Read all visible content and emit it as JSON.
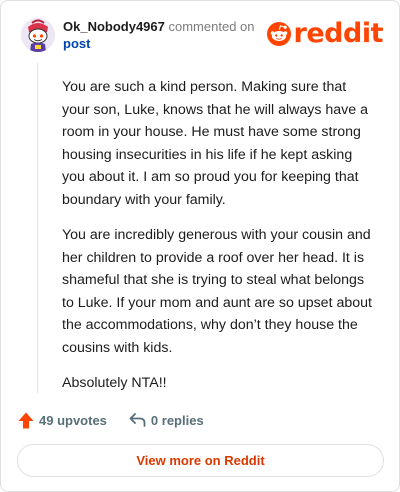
{
  "header": {
    "username": "Ok_Nobody4967",
    "commented_text": "commented on",
    "post_link": "post",
    "logo_text": "reddit"
  },
  "comment": {
    "paragraphs": [
      "You are such a kind person. Making sure that your son, Luke, knows that he will always have a room in your house. He must have some strong housing insecurities in his life if he kept asking you about it. I am so proud you for keeping that boundary with your family.",
      "You are incredibly generous with your cousin and her children to provide a roof over her head. It is shameful that she is trying to steal what belongs to Luke. If your mom and aunt are so upset about the accommodations, why don’t they house the cousins with kids.",
      "Absolutely NTA!!"
    ]
  },
  "actions": {
    "upvotes": "49 upvotes",
    "replies": "0 replies"
  },
  "footer": {
    "view_more": "View more on Reddit"
  },
  "colors": {
    "brand": "#ff4500",
    "link": "#0045ac",
    "view_more_text": "#d93900"
  }
}
